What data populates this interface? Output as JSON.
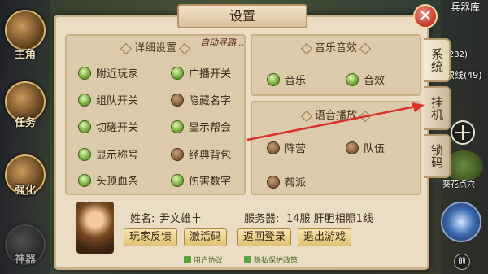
{
  "window": {
    "title": "设置"
  },
  "left_hud": {
    "items": [
      {
        "label": "主角"
      },
      {
        "label": "任务"
      },
      {
        "label": "强化"
      },
      {
        "label": "神器"
      }
    ]
  },
  "right_hud": {
    "top_label": "兵器库",
    "route_label": "眼线(49)",
    "level_label": "(232)",
    "bottom_label": "葵花点穴",
    "bottom_btn": "前"
  },
  "tabs": [
    {
      "label": "系统"
    },
    {
      "label": "挂机"
    },
    {
      "label": "锁码"
    }
  ],
  "detail_settings": {
    "title": "详细设置",
    "options": [
      {
        "label": "附近玩家",
        "on": true
      },
      {
        "label": "广播开关",
        "on": true
      },
      {
        "label": "组队开关",
        "on": true
      },
      {
        "label": "隐藏名字",
        "on": false
      },
      {
        "label": "切磋开关",
        "on": true
      },
      {
        "label": "显示帮会",
        "on": true
      },
      {
        "label": "显示称号",
        "on": true
      },
      {
        "label": "经典背包",
        "on": false
      },
      {
        "label": "头顶血条",
        "on": true
      },
      {
        "label": "伤害数字",
        "on": true
      }
    ]
  },
  "auto_pathfinding": {
    "label": "自动寻路..."
  },
  "music_settings": {
    "title": "音乐音效",
    "options": [
      {
        "label": "音乐",
        "on": true
      },
      {
        "label": "音效",
        "on": true
      }
    ]
  },
  "voice_settings": {
    "title": "语音播放",
    "options": [
      {
        "label": "阵营",
        "on": false
      },
      {
        "label": "队伍",
        "on": false
      },
      {
        "label": "帮派",
        "on": false
      }
    ]
  },
  "player": {
    "name_label": "姓名:",
    "name": "尹文雄丰",
    "server_label": "服务器:",
    "server": "14服 肝胆相照1线"
  },
  "actions": {
    "feedback": "玩家反馈",
    "activation_code": "激活码",
    "back_to_login": "返回登录",
    "quit_game": "退出游戏"
  },
  "footer": {
    "user_agreement": "用户协议",
    "privacy_policy": "隐私保护政策"
  },
  "colors": {
    "on": "#7db040",
    "off": "#8a6240",
    "annotation_arrow": "#d8322a"
  }
}
